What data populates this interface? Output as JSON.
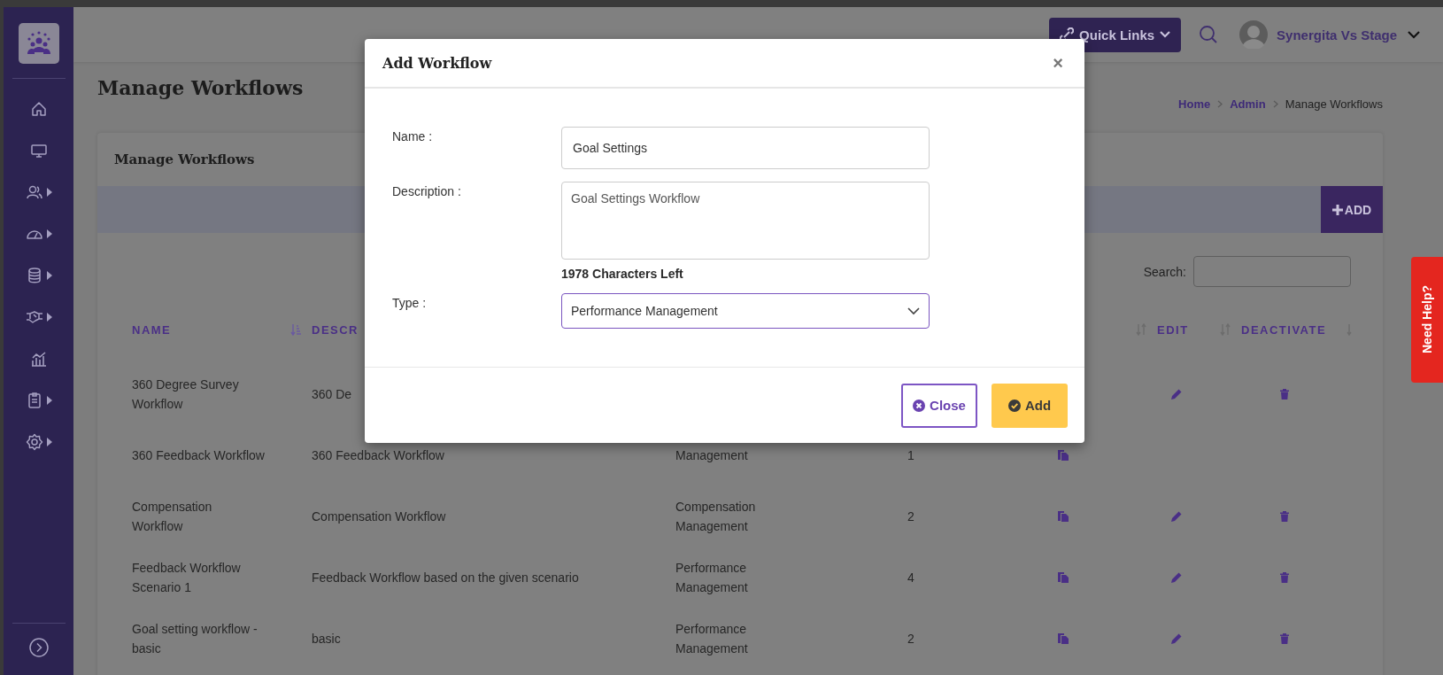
{
  "sidebar": {
    "items": [
      {
        "has_submenu": false
      },
      {
        "has_submenu": false
      },
      {
        "has_submenu": true
      },
      {
        "has_submenu": true
      },
      {
        "has_submenu": true
      },
      {
        "has_submenu": true
      },
      {
        "has_submenu": false
      },
      {
        "has_submenu": true
      },
      {
        "has_submenu": true
      }
    ]
  },
  "top_bar": {
    "quick_links": "Quick Links",
    "user_name": "Synergita Vs Stage"
  },
  "page": {
    "title": "Manage Workflows",
    "breadcrumb": [
      {
        "label": "Home",
        "link": true
      },
      {
        "label": "Admin",
        "link": true
      },
      {
        "label": "Manage Workflows",
        "link": false
      }
    ]
  },
  "card": {
    "title": "Manage Workflows",
    "add_button": "ADD",
    "search_label": "Search:"
  },
  "table": {
    "columns": [
      {
        "label": "NAME",
        "kind": "sorted-asc"
      },
      {
        "label": "DESCR"
      },
      {},
      {},
      {
        "kind": "sortable"
      },
      {
        "label": "EDIT",
        "kind": "sortable"
      },
      {
        "label": "DEACTIVATE",
        "kind": "sorted-desc"
      }
    ],
    "rows": [
      {
        "name": "360 Degree Survey Workflow",
        "description": "360 De",
        "edit": true,
        "deactivate": true
      },
      {
        "name": "360 Feedback Workflow",
        "description": "360 Feedback Workflow",
        "type": "Management",
        "count": "1",
        "copy": true,
        "edit": false,
        "deactivate": false
      },
      {
        "name": "Compensation Workflow",
        "description": "Compensation Workflow",
        "type": "Compensation Management",
        "count": "2",
        "copy": true,
        "edit": true,
        "deactivate": true
      },
      {
        "name": "Feedback Workflow Scenario 1",
        "description": "Feedback Workflow based on the given scenario",
        "type": "Performance Management",
        "count": "4",
        "copy": true,
        "edit": true,
        "deactivate": true
      },
      {
        "name": "Goal setting workflow - basic",
        "description": "basic",
        "type": "Performance Management",
        "count": "2",
        "copy": true,
        "edit": true,
        "deactivate": true
      }
    ]
  },
  "modal": {
    "title": "Add Workflow",
    "close": "×",
    "fields": [
      {
        "kind": "text",
        "label": "Name :",
        "value": "Goal Settings"
      },
      {
        "kind": "textarea",
        "label": "Description :",
        "value": "Goal Settings Workflow",
        "counter": "1978 Characters Left"
      },
      {
        "kind": "select",
        "label": "Type :",
        "value": "Performance Management",
        "focused": true
      }
    ],
    "buttons": [
      {
        "kind": "outline",
        "label": "Close"
      },
      {
        "kind": "primary",
        "label": "Add"
      }
    ]
  },
  "help_tab": "Need Help?"
}
